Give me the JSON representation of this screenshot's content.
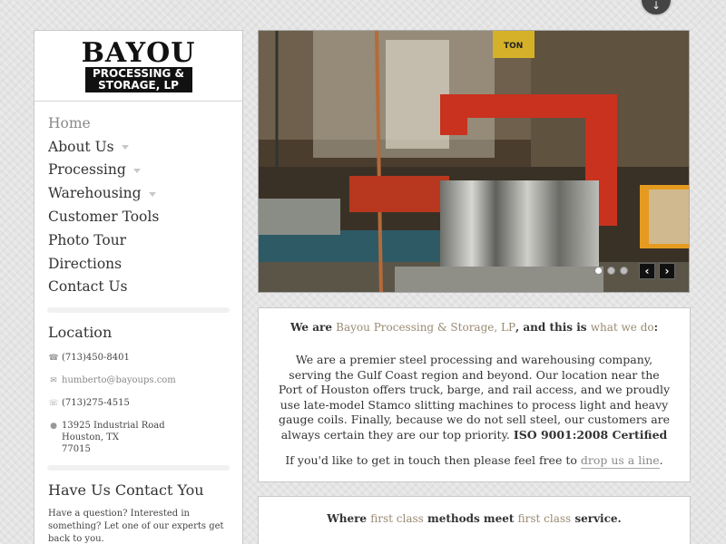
{
  "logo": {
    "line1": "BAYOU",
    "line2": "PROCESSING &",
    "line3": "STORAGE, LP"
  },
  "nav": {
    "items": [
      {
        "label": "Home",
        "active": true,
        "has_submenu": false
      },
      {
        "label": "About Us",
        "active": false,
        "has_submenu": true
      },
      {
        "label": "Processing",
        "active": false,
        "has_submenu": true
      },
      {
        "label": "Warehousing",
        "active": false,
        "has_submenu": true
      },
      {
        "label": "Customer Tools",
        "active": false,
        "has_submenu": false
      },
      {
        "label": "Photo Tour",
        "active": false,
        "has_submenu": false
      },
      {
        "label": "Directions",
        "active": false,
        "has_submenu": false
      },
      {
        "label": "Contact Us",
        "active": false,
        "has_submenu": false
      }
    ]
  },
  "location": {
    "title": "Location",
    "phone": "(713)450-8401",
    "email": "humberto@bayoups.com",
    "fax": "(713)275-4515",
    "address_line1": "13925 Industrial Road",
    "address_line2": "Houston, TX",
    "address_line3": "77015"
  },
  "contact_section": {
    "title": "Have Us Contact You",
    "blurb": "Have a question? Interested in something? Let one of our experts get back to you."
  },
  "slider": {
    "sign_text": "TON",
    "dots": [
      true,
      false,
      false
    ],
    "prev_icon": "chevron-left-icon",
    "next_icon": "chevron-right-icon"
  },
  "intro": {
    "lead_prefix": "We are ",
    "company": "Bayou Processing & Storage, LP",
    "lead_middle": ", and this is ",
    "what_we_do": "what we do",
    "lead_suffix": ":",
    "paragraph": "We are a premier steel processing and warehousing company, serving the Gulf Coast region and beyond. Our location near the Port of Houston offers truck, barge, and rail access, and we proudly use late-model Stamco slitting machines to process light and heavy gauge coils. Finally, because we do not sell steel, our customers are always certain they are our top priority.",
    "certification": "ISO 9001:2008 Certified",
    "cta_prefix": "If you'd like to get in touch then please feel free to ",
    "cta_link": "drop us a line",
    "cta_suffix": "."
  },
  "tagline": {
    "part1": "Where ",
    "hl1": "first class",
    "part2": " methods meet ",
    "hl2": "first class",
    "part3": " service."
  },
  "colors": {
    "accent": "#9a8a73",
    "background": "#e4e4e4"
  }
}
